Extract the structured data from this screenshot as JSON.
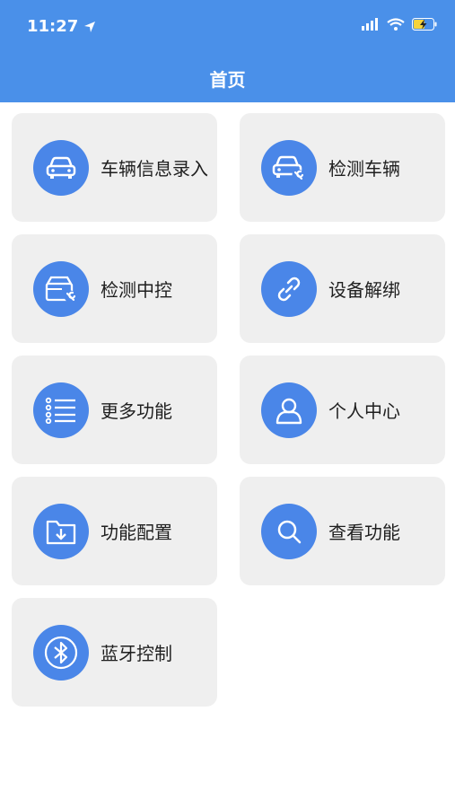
{
  "status_bar": {
    "time": "11:27"
  },
  "header": {
    "title": "首页"
  },
  "menu": [
    {
      "label": "车辆信息录入",
      "icon": "car-icon"
    },
    {
      "label": "检测车辆",
      "icon": "car-wrench-icon"
    },
    {
      "label": "检测中控",
      "icon": "console-wrench-icon"
    },
    {
      "label": "设备解绑",
      "icon": "link-icon"
    },
    {
      "label": "更多功能",
      "icon": "list-icon"
    },
    {
      "label": "个人中心",
      "icon": "user-icon"
    },
    {
      "label": "功能配置",
      "icon": "folder-download-icon"
    },
    {
      "label": "查看功能",
      "icon": "search-icon"
    },
    {
      "label": "蓝牙控制",
      "icon": "bluetooth-icon"
    }
  ],
  "colors": {
    "header": "#4a90e9",
    "icon_circle": "#4a86e8",
    "card": "#efefef"
  }
}
